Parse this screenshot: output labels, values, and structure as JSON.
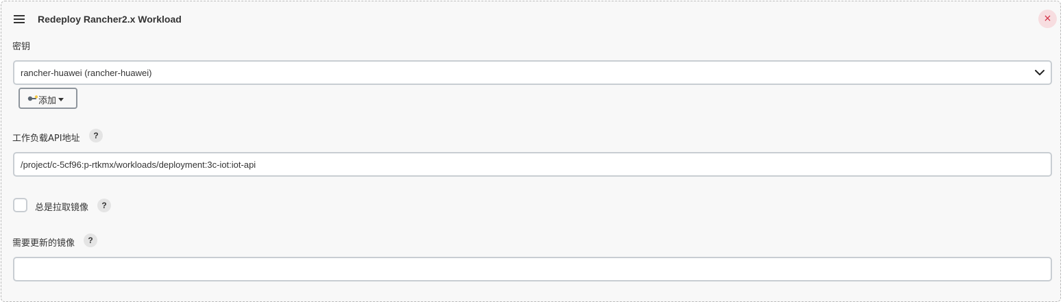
{
  "panel": {
    "title": "Redeploy Rancher2.x Workload",
    "drag_icon": "hamburger-icon",
    "close_icon": "close-icon",
    "close_symbol": "×",
    "accent_color": "#d0243a"
  },
  "credentials": {
    "label": "密钥",
    "selected": "rancher-huawei (rancher-huawei)",
    "add_label": "添加",
    "add_icon": "key-icon"
  },
  "workload_api": {
    "label": "工作负载API地址",
    "help": "?",
    "value": "/project/c-5cf96:p-rtkmx/workloads/deployment:3c-iot:iot-api"
  },
  "always_pull": {
    "label": "总是拉取镜像",
    "help": "?",
    "checked": false
  },
  "update_images": {
    "label": "需要更新的镜像",
    "help": "?",
    "value": ""
  }
}
